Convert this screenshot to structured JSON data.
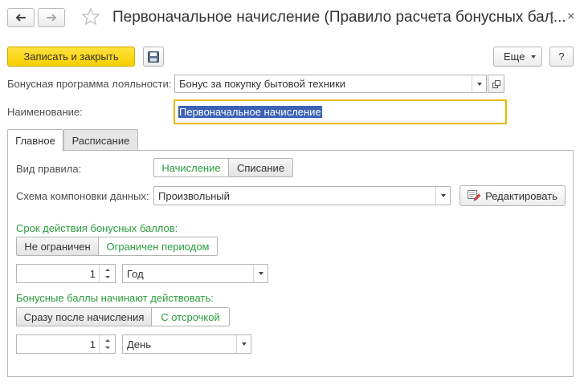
{
  "window": {
    "title": "Первоначальное начисление (Правило расчета бонусных бал...",
    "more_glyph": "⋮",
    "close_glyph": "×"
  },
  "toolbar": {
    "save_close_label": "Записать и закрыть",
    "more_label": "Еще",
    "help_label": "?"
  },
  "fields": {
    "loyalty_program_label": "Бонусная программа лояльности:",
    "loyalty_program_value": "Бонус за покупку бытовой техники",
    "name_label": "Наименование:",
    "name_value": "Первоначальное начисление"
  },
  "tabs": [
    {
      "label": "Главное",
      "active": true
    },
    {
      "label": "Расписание",
      "active": false
    }
  ],
  "main": {
    "rule_type_label": "Вид правила:",
    "rule_type_options": [
      "Начисление",
      "Списание"
    ],
    "rule_type_selected": "Начисление",
    "schema_label": "Схема компоновки данных:",
    "schema_value": "Произвольный",
    "edit_label": "Редактировать",
    "validity_header": "Срок действия бонусных баллов:",
    "validity_options": [
      "Не ограничен",
      "Ограничен периодом"
    ],
    "validity_selected": "Ограничен периодом",
    "validity_count": "1",
    "validity_unit": "Год",
    "start_header": "Бонусные баллы начинают действовать:",
    "start_options": [
      "Сразу после начисления",
      "С отсрочкой"
    ],
    "start_selected": "С отсрочкой",
    "delay_count": "1",
    "delay_unit": "День"
  },
  "colors": {
    "accent_green": "#2a9d3b",
    "primary_button": "#f7cf00",
    "selection_highlight": "#3b62b5",
    "focus_border": "#e6b800"
  }
}
